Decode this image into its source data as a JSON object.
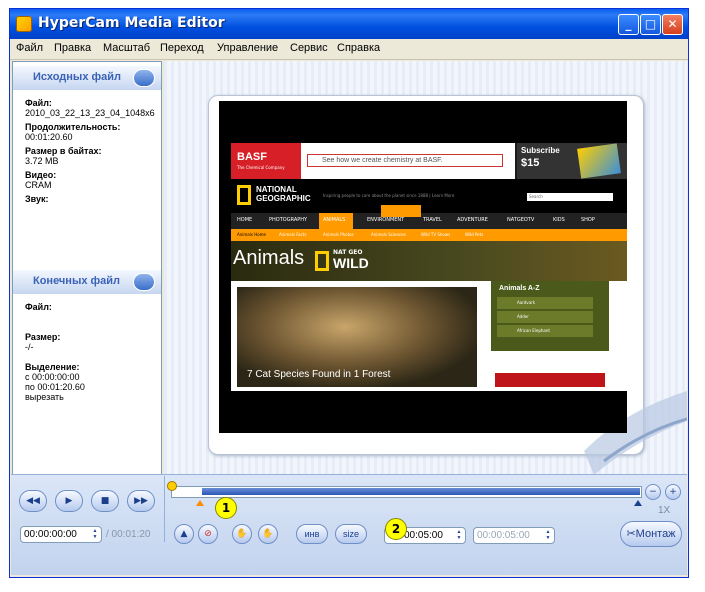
{
  "window": {
    "title": "HyperCam Media Editor",
    "controls": [
      "_",
      "□",
      "✕"
    ]
  },
  "menu": [
    "Файл",
    "Правка",
    "Масштаб",
    "Переход",
    "Управление",
    "Сервис",
    "Справка"
  ],
  "source": {
    "header": "Исходных файл",
    "file_label": "Файл:",
    "file_value": "2010_03_22_13_23_04_1048x6",
    "duration_label": "Продолжительность:",
    "duration_value": "00:01:20.60",
    "size_label": "Размер в байтах:",
    "size_value": "3.72 MB",
    "video_label": "Видео:",
    "video_value": "CRAM",
    "audio_label": "Звук:"
  },
  "target": {
    "header": "Конечных файл",
    "file_label": "Файл:",
    "size_label": "Размер:",
    "size_value": "-/-",
    "selection_label": "Выделение:",
    "from_value": "с 00:00:00:00",
    "to_value": "по     00:01:20.60",
    "cut_value": "вырезать"
  },
  "site": {
    "ad_brand": "BASF",
    "ad_brand_sub": "The Chemical Company",
    "ad_text": "See how we create chemistry at BASF.",
    "subscribe_title": "Subscribe",
    "subscribe_price": "$15",
    "logo_line1": "NATIONAL",
    "logo_line2": "GEOGRAPHIC",
    "tagline": "Inspiring people to care about the planet since 1888  |  Learn More",
    "search_placeholder": "Search",
    "nav": [
      "HOME",
      "PHOTOGRAPHY",
      "ANIMALS",
      "ENVIRONMENT",
      "TRAVEL",
      "ADVENTURE",
      "NATGEOTV",
      "KIDS",
      "SHOP"
    ],
    "subnav": [
      "Animals Home",
      "Animals Facts",
      "Animals Photos",
      "Animals Sciences",
      "Wild TV Shows",
      "Wild Pets"
    ],
    "banner_word": "Animals",
    "banner_brand_top": "NAT GEO",
    "banner_brand_bottom": "WILD",
    "feature_caption": "7 Cat Species Found in 1 Forest",
    "side_title": "Animals A-Z",
    "side_items": [
      "Aardvark",
      "Adder",
      "African Elephant"
    ]
  },
  "controls": {
    "time_current": "00:00:00:00",
    "time_total": "/ 00:01:20",
    "selection_end": "00:05:00",
    "selection_end_dis": "00:00:05:00",
    "btn_inv": "инв",
    "btn_size": "size",
    "zoom_label": "1X",
    "montage_label": "Монтаж",
    "callout_1": "1",
    "callout_2": "2"
  },
  "colors": {
    "title_blue": "#0a5ef0",
    "natgeo_yellow": "#ffce00",
    "callout": "#ffff00"
  }
}
